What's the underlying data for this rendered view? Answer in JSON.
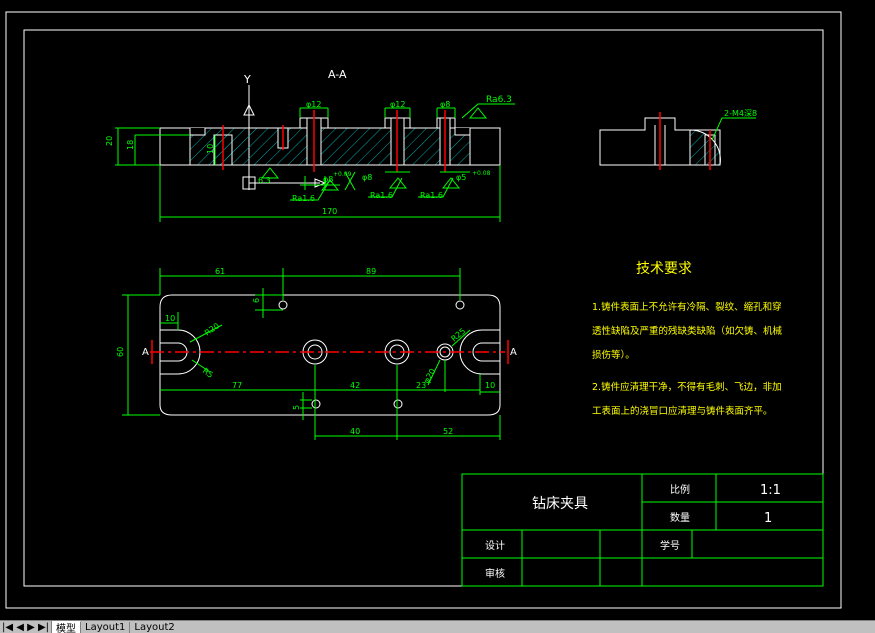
{
  "section": {
    "title": "A-A",
    "axis_y": "Y",
    "roughness_top": "Ra6.3",
    "dim_top_1": "φ12",
    "dim_top_2": "φ12",
    "dim_top_3": "φ8",
    "dim_h_total": "20",
    "dim_h_inner": "18",
    "dim_h_small": "10",
    "hole_8": "φ8",
    "hole_8_tol": "+0.09",
    "hole_8b": "φ8",
    "hole_5": "φ5",
    "hole_5_tol": "+0.08",
    "ra_1": "Ra1.6",
    "ra_2": "Ra1.6",
    "ra_3": "Ra1.6",
    "ra_4": "6.3",
    "dim_length": "170"
  },
  "side_view": {
    "callout": "2-M4深8"
  },
  "plan": {
    "dim_61": "61",
    "dim_89": "89",
    "dim_6": "6",
    "dim_10_left": "10",
    "dim_r20": "R20",
    "dim_r5": "R5",
    "dim_60": "60",
    "dim_77": "77",
    "dim_42": "42",
    "dim_23": "23",
    "dim_10_right": "10",
    "dim_r25": "R25",
    "dim_phi20": "φ20",
    "dim_5": "5",
    "dim_40": "40",
    "dim_52": "52",
    "label_a_left": "A",
    "label_a_right": "A"
  },
  "requirements": {
    "title": "技术要求",
    "line1": "1.铸件表面上不允许有冷隔、裂纹、缩孔和穿",
    "line2": "透性缺陷及严重的残缺类缺陷（如欠铸、机械",
    "line3": "损伤等）。",
    "line4": "2.铸件应清理干净，不得有毛刺、飞边，非加",
    "line5": "工表面上的浇冒口应清理与铸件表面齐平。"
  },
  "title_block": {
    "name": "钻床夹具",
    "scale_label": "比例",
    "scale_value": "1:1",
    "qty_label": "数量",
    "qty_value": "1",
    "design_label": "设计",
    "check_label": "审核",
    "drawing_no_label": "学号"
  },
  "tabs": {
    "nav": "|◀ ◀ ▶ ▶|",
    "model": "模型",
    "layout1": "Layout1",
    "layout2": "Layout2"
  },
  "colors": {
    "background": "#000000",
    "outline": "#ffffff",
    "dimension": "#00ff00",
    "centerline": "#ff0000",
    "hatch": "#00ffff"
  }
}
